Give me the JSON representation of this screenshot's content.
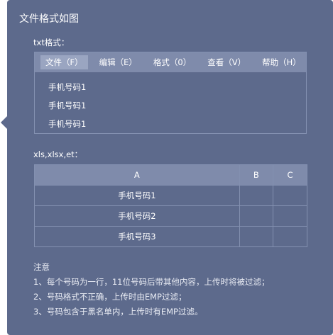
{
  "title": "文件格式如图",
  "txt_section": {
    "label": "txt格式：",
    "menu": [
      "文件（F）",
      "编辑（E）",
      "格式（0）",
      "查看（V）",
      "帮助（H）"
    ],
    "lines": [
      "手机号码1",
      "手机号码1",
      "手机号码1"
    ]
  },
  "xls_section": {
    "label": "xls,xlsx,et：",
    "columns": [
      "A",
      "B",
      "C"
    ],
    "rows": [
      [
        "手机号码1",
        "",
        ""
      ],
      [
        "手机号码2",
        "",
        ""
      ],
      [
        "手机号码3",
        "",
        ""
      ]
    ]
  },
  "notes": {
    "heading": "注意",
    "items": [
      "1、每个号码为一行，11位号码后带其他内容，上传时将被过滤；",
      "2、号码格式不正确，上传时由EMP过滤；",
      "3、号码包含于黑名单内，上传时有EMP过滤。"
    ]
  },
  "colors": {
    "panel": "#5d6a8c",
    "header": "#7f8bab",
    "border": "#8390b0",
    "active_menu": "#9aa5c1"
  }
}
